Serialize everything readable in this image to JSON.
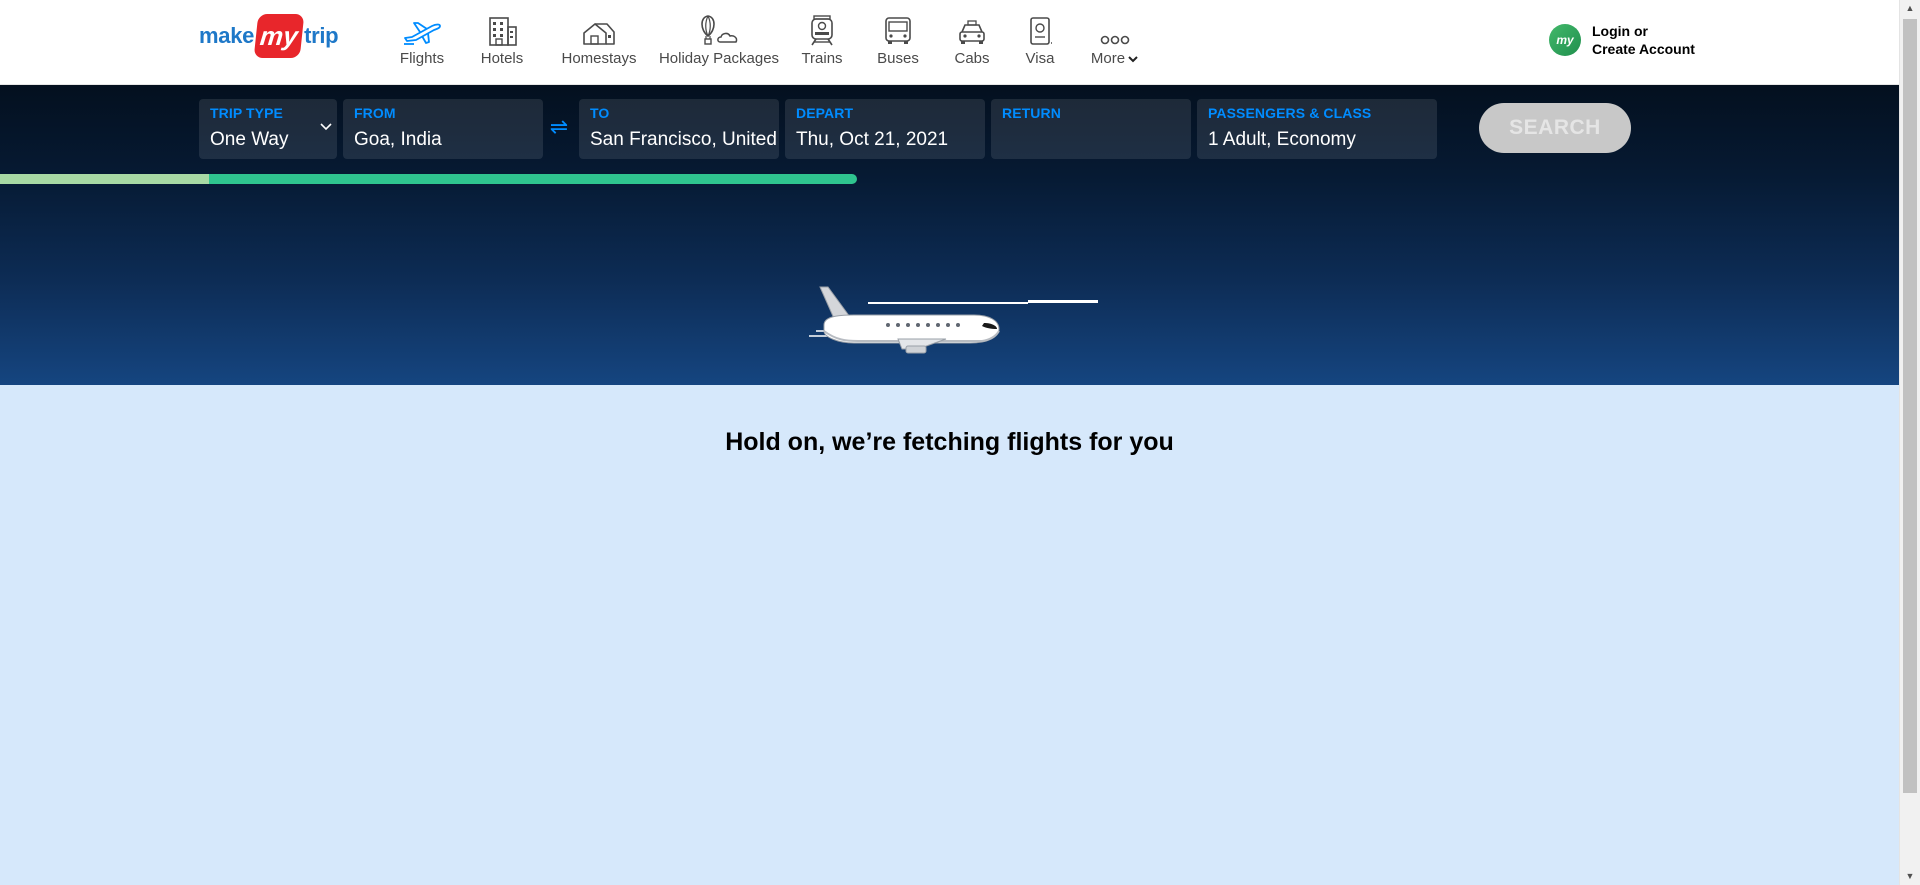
{
  "brand": {
    "make": "make",
    "my": "my",
    "trip": "trip"
  },
  "nav": {
    "items": [
      {
        "label": "Flights",
        "icon": "airplane-icon"
      },
      {
        "label": "Hotels",
        "icon": "building-icon"
      },
      {
        "label": "Homestays",
        "icon": "house-icon"
      },
      {
        "label": "Holiday Packages",
        "icon": "hot-air-balloon-icon"
      },
      {
        "label": "Trains",
        "icon": "train-icon"
      },
      {
        "label": "Buses",
        "icon": "bus-icon"
      },
      {
        "label": "Cabs",
        "icon": "car-icon"
      },
      {
        "label": "Visa",
        "icon": "passport-icon"
      },
      {
        "label": "More",
        "icon": "more-dots-icon"
      }
    ]
  },
  "account": {
    "avatar": "my",
    "line1": "Login or",
    "line2": "Create Account"
  },
  "search": {
    "trip_type": {
      "label": "TRIP TYPE",
      "value": "One Way"
    },
    "from": {
      "label": "FROM",
      "value": "Goa, India"
    },
    "to": {
      "label": "TO",
      "value": "San Francisco, United States"
    },
    "depart": {
      "label": "DEPART",
      "value": "Thu, Oct 21, 2021"
    },
    "return": {
      "label": "RETURN",
      "value": ""
    },
    "passengers": {
      "label": "PASSENGERS & CLASS",
      "value": "1 Adult, Economy"
    },
    "swap_icon": "⇌",
    "button": "SEARCH"
  },
  "progress": {
    "completed_fraction": 0.244,
    "loaded_fraction": 1.0
  },
  "status_message": "Hold on, we’re fetching flights for you",
  "colors": {
    "accent": "#008cff",
    "brand_red": "#e8262b",
    "brand_blue": "#1e78c8",
    "progress": "#2fc48f",
    "background": "#d6e8fb"
  }
}
